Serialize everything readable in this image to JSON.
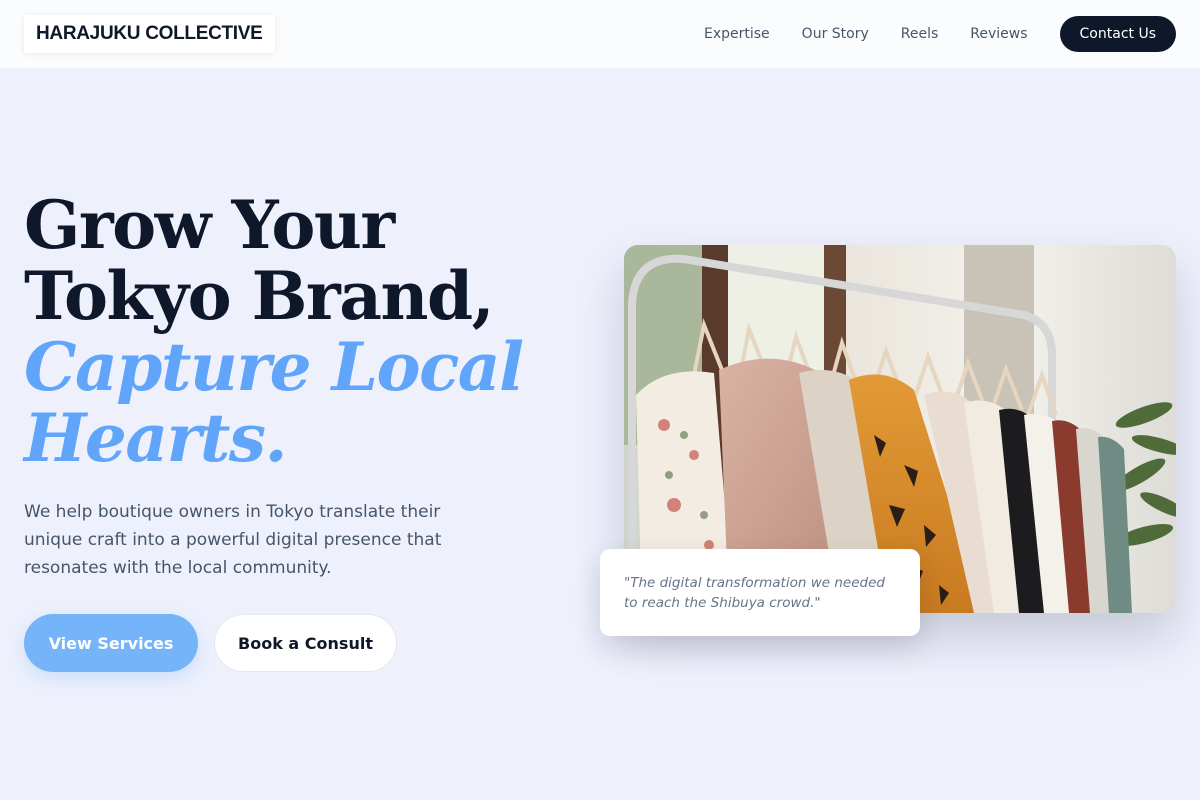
{
  "brand": {
    "name": "HARAJUKU COLLECTIVE"
  },
  "nav": {
    "links": [
      "Expertise",
      "Our Story",
      "Reels",
      "Reviews"
    ],
    "cta": "Contact Us"
  },
  "hero": {
    "title_lines": [
      "Grow Your",
      "Tokyo Brand,"
    ],
    "accent_lines": [
      "Capture Local",
      "Hearts."
    ],
    "subtitle": "We help boutique owners in Tokyo translate their unique craft into a powerful digital presence that resonates with the local community.",
    "primary_button": "View Services",
    "secondary_button": "Book a Consult"
  },
  "testimonial": {
    "quote": "\"The digital transformation we needed to reach the Shibuya crowd.\""
  },
  "image": {
    "icon": "clothing-rack-photo"
  },
  "colors": {
    "accent": "#60a5fa",
    "dark": "#0f172a",
    "background": "#eef1fc",
    "primary_button": "#76b4f9"
  }
}
